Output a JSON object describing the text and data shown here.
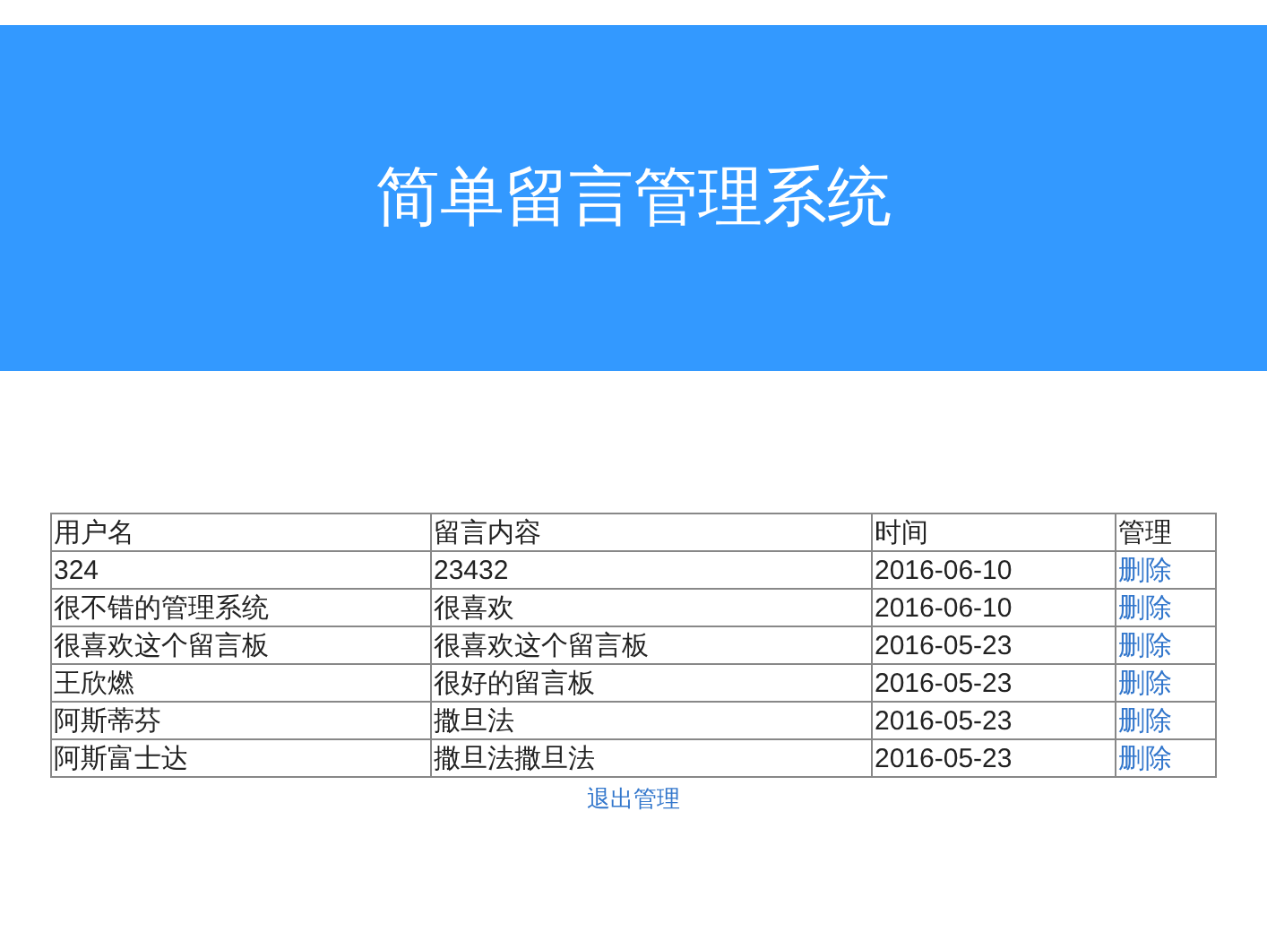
{
  "header": {
    "title": "简单留言管理系统"
  },
  "table": {
    "columns": [
      "用户名",
      "留言内容",
      "时间",
      "管理"
    ],
    "rows": [
      {
        "username": "324",
        "content": "23432",
        "time": "2016-06-10",
        "action": "删除"
      },
      {
        "username": "很不错的管理系统",
        "content": "很喜欢",
        "time": "2016-06-10",
        "action": "删除"
      },
      {
        "username": "很喜欢这个留言板",
        "content": "很喜欢这个留言板",
        "time": "2016-05-23",
        "action": "删除"
      },
      {
        "username": "王欣燃",
        "content": "很好的留言板",
        "time": "2016-05-23",
        "action": "删除"
      },
      {
        "username": "阿斯蒂芬",
        "content": "撒旦法",
        "time": "2016-05-23",
        "action": "删除"
      },
      {
        "username": "阿斯富士达",
        "content": "撒旦法撒旦法",
        "time": "2016-05-23",
        "action": "删除"
      }
    ]
  },
  "logout_link": "退出管理"
}
